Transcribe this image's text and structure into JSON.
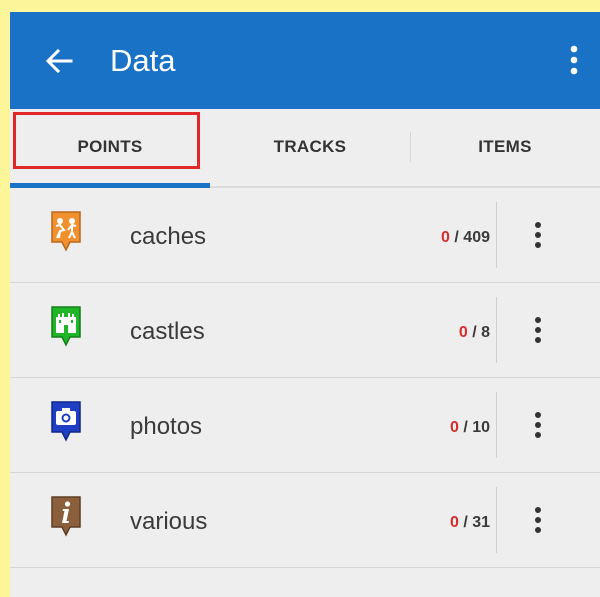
{
  "appbar": {
    "title": "Data",
    "back_icon": "arrow-left-icon",
    "menu_icon": "more-vert-icon",
    "color": "#1a72c6"
  },
  "tabs": [
    {
      "label": "POINTS",
      "selected": true
    },
    {
      "label": "TRACKS",
      "selected": false
    },
    {
      "label": "ITEMS",
      "selected": false
    }
  ],
  "highlight_color": "#e0282b",
  "folders": [
    {
      "name": "caches",
      "visible": "0",
      "total": "/ 409",
      "icon": "caches-pin-icon",
      "icon_color": "#f0902e"
    },
    {
      "name": "castles",
      "visible": "0",
      "total": "/ 8",
      "icon": "castle-pin-icon",
      "icon_color": "#1fb526"
    },
    {
      "name": "photos",
      "visible": "0",
      "total": "/ 10",
      "icon": "camera-pin-icon",
      "icon_color": "#1e3fc4"
    },
    {
      "name": "various",
      "visible": "0",
      "total": "/ 31",
      "icon": "info-pin-icon",
      "icon_color": "#8b5e3c"
    }
  ]
}
